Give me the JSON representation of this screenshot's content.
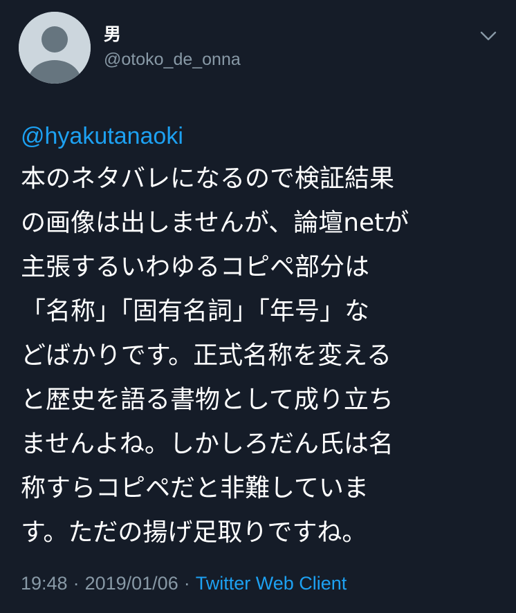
{
  "author": {
    "display_name": "男",
    "username": "@otoko_de_onna",
    "avatar_icon": "default-avatar-icon"
  },
  "menu": {
    "icon": "chevron-down-icon"
  },
  "tweet": {
    "mention": "@hyakutanaoki",
    "lines": [
      "本のネタバレになるので検証結果",
      "の画像は出しませんが、論壇netが",
      "主張するいわゆるコピペ部分は",
      "「名称」「固有名詞」「年号」な",
      "どばかりです。正式名称を変える",
      "と歴史を語る書物として成り立ち",
      "ませんよね。しかしろだん氏は名",
      "称すらコピペだと非難していま",
      "す。ただの揚げ足取りですね。"
    ]
  },
  "meta": {
    "time": "19:48",
    "separator": "·",
    "date": "2019/01/06",
    "source": "Twitter Web Client"
  },
  "colors": {
    "background": "#151c28",
    "text": "#ffffff",
    "secondary": "#8899a6",
    "link": "#1da1f2"
  }
}
